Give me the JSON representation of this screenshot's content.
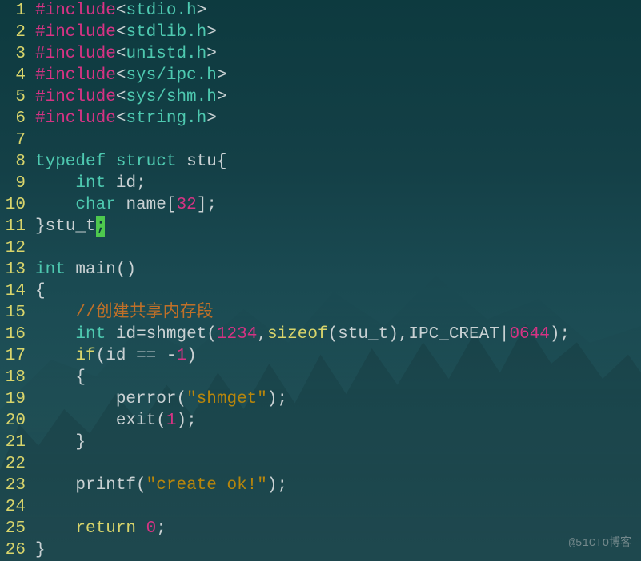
{
  "watermark": "@51CTO博客",
  "code_lines": [
    {
      "ln": "1",
      "tokens": [
        {
          "t": "#include",
          "c": "preproc"
        },
        {
          "t": "<",
          "c": "angle"
        },
        {
          "t": "stdio.h",
          "c": "header-name"
        },
        {
          "t": ">",
          "c": "angle"
        }
      ]
    },
    {
      "ln": "2",
      "tokens": [
        {
          "t": "#include",
          "c": "preproc"
        },
        {
          "t": "<",
          "c": "angle"
        },
        {
          "t": "stdlib.h",
          "c": "header-name"
        },
        {
          "t": ">",
          "c": "angle"
        }
      ]
    },
    {
      "ln": "3",
      "tokens": [
        {
          "t": "#include",
          "c": "preproc"
        },
        {
          "t": "<",
          "c": "angle"
        },
        {
          "t": "unistd.h",
          "c": "header-name"
        },
        {
          "t": ">",
          "c": "angle"
        }
      ]
    },
    {
      "ln": "4",
      "tokens": [
        {
          "t": "#include",
          "c": "preproc"
        },
        {
          "t": "<",
          "c": "angle"
        },
        {
          "t": "sys/ipc.h",
          "c": "header-name"
        },
        {
          "t": ">",
          "c": "angle"
        }
      ]
    },
    {
      "ln": "5",
      "tokens": [
        {
          "t": "#include",
          "c": "preproc"
        },
        {
          "t": "<",
          "c": "angle"
        },
        {
          "t": "sys/shm.h",
          "c": "header-name"
        },
        {
          "t": ">",
          "c": "angle"
        }
      ]
    },
    {
      "ln": "6",
      "tokens": [
        {
          "t": "#include",
          "c": "preproc"
        },
        {
          "t": "<",
          "c": "angle"
        },
        {
          "t": "string.h",
          "c": "header-name"
        },
        {
          "t": ">",
          "c": "angle"
        }
      ]
    },
    {
      "ln": "7",
      "tokens": []
    },
    {
      "ln": "8",
      "tokens": [
        {
          "t": "typedef",
          "c": "typedef"
        },
        {
          "t": " ",
          "c": "op"
        },
        {
          "t": "struct",
          "c": "struct-kw"
        },
        {
          "t": " ",
          "c": "op"
        },
        {
          "t": "stu",
          "c": "ident"
        },
        {
          "t": "{",
          "c": "brace"
        }
      ]
    },
    {
      "ln": "9",
      "tokens": [
        {
          "t": "    ",
          "c": "op"
        },
        {
          "t": "int",
          "c": "type"
        },
        {
          "t": " ",
          "c": "op"
        },
        {
          "t": "id",
          "c": "ident"
        },
        {
          "t": ";",
          "c": "op"
        }
      ]
    },
    {
      "ln": "10",
      "tokens": [
        {
          "t": "    ",
          "c": "op"
        },
        {
          "t": "char",
          "c": "type"
        },
        {
          "t": " ",
          "c": "op"
        },
        {
          "t": "name",
          "c": "ident"
        },
        {
          "t": "[",
          "c": "paren"
        },
        {
          "t": "32",
          "c": "num"
        },
        {
          "t": "]",
          "c": "paren"
        },
        {
          "t": ";",
          "c": "op"
        }
      ]
    },
    {
      "ln": "11",
      "tokens": [
        {
          "t": "}",
          "c": "brace"
        },
        {
          "t": "stu_t",
          "c": "ident"
        },
        {
          "t": ";",
          "c": "cursor"
        }
      ]
    },
    {
      "ln": "12",
      "tokens": []
    },
    {
      "ln": "13",
      "tokens": [
        {
          "t": "int",
          "c": "type"
        },
        {
          "t": " ",
          "c": "op"
        },
        {
          "t": "main",
          "c": "ident"
        },
        {
          "t": "()",
          "c": "paren"
        }
      ]
    },
    {
      "ln": "14",
      "tokens": [
        {
          "t": "{",
          "c": "brace"
        }
      ]
    },
    {
      "ln": "15",
      "tokens": [
        {
          "t": "    ",
          "c": "op"
        },
        {
          "t": "//创建共享内存段",
          "c": "comment"
        }
      ]
    },
    {
      "ln": "16",
      "tokens": [
        {
          "t": "    ",
          "c": "op"
        },
        {
          "t": "int",
          "c": "type"
        },
        {
          "t": " ",
          "c": "op"
        },
        {
          "t": "id",
          "c": "ident"
        },
        {
          "t": "=",
          "c": "op"
        },
        {
          "t": "shmget",
          "c": "func-call"
        },
        {
          "t": "(",
          "c": "paren"
        },
        {
          "t": "1234",
          "c": "num"
        },
        {
          "t": ",",
          "c": "op"
        },
        {
          "t": "sizeof",
          "c": "sizeof-kw"
        },
        {
          "t": "(",
          "c": "paren"
        },
        {
          "t": "stu_t",
          "c": "ident"
        },
        {
          "t": ")",
          "c": "paren"
        },
        {
          "t": ",",
          "c": "op"
        },
        {
          "t": "IPC_CREAT",
          "c": "ident"
        },
        {
          "t": "|",
          "c": "op"
        },
        {
          "t": "0",
          "c": "num"
        },
        {
          "t": "644",
          "c": "num"
        },
        {
          "t": ")",
          "c": "paren"
        },
        {
          "t": ";",
          "c": "op"
        }
      ]
    },
    {
      "ln": "17",
      "tokens": [
        {
          "t": "    ",
          "c": "op"
        },
        {
          "t": "if",
          "c": "if-kw"
        },
        {
          "t": "(",
          "c": "paren"
        },
        {
          "t": "id ",
          "c": "ident"
        },
        {
          "t": "==",
          "c": "op"
        },
        {
          "t": " ",
          "c": "op"
        },
        {
          "t": "-",
          "c": "op"
        },
        {
          "t": "1",
          "c": "num"
        },
        {
          "t": ")",
          "c": "paren"
        }
      ]
    },
    {
      "ln": "18",
      "tokens": [
        {
          "t": "    ",
          "c": "op"
        },
        {
          "t": "{",
          "c": "brace"
        }
      ]
    },
    {
      "ln": "19",
      "tokens": [
        {
          "t": "        ",
          "c": "op"
        },
        {
          "t": "perror",
          "c": "func-call"
        },
        {
          "t": "(",
          "c": "paren"
        },
        {
          "t": "\"shmget\"",
          "c": "str"
        },
        {
          "t": ")",
          "c": "paren"
        },
        {
          "t": ";",
          "c": "op"
        }
      ]
    },
    {
      "ln": "20",
      "tokens": [
        {
          "t": "        ",
          "c": "op"
        },
        {
          "t": "exit",
          "c": "func-call"
        },
        {
          "t": "(",
          "c": "paren"
        },
        {
          "t": "1",
          "c": "num"
        },
        {
          "t": ")",
          "c": "paren"
        },
        {
          "t": ";",
          "c": "op"
        }
      ]
    },
    {
      "ln": "21",
      "tokens": [
        {
          "t": "    ",
          "c": "op"
        },
        {
          "t": "}",
          "c": "brace"
        }
      ]
    },
    {
      "ln": "22",
      "tokens": []
    },
    {
      "ln": "23",
      "tokens": [
        {
          "t": "    ",
          "c": "op"
        },
        {
          "t": "printf",
          "c": "func-call"
        },
        {
          "t": "(",
          "c": "paren"
        },
        {
          "t": "\"create ok!\"",
          "c": "str"
        },
        {
          "t": ")",
          "c": "paren"
        },
        {
          "t": ";",
          "c": "op"
        }
      ]
    },
    {
      "ln": "24",
      "tokens": []
    },
    {
      "ln": "25",
      "tokens": [
        {
          "t": "    ",
          "c": "op"
        },
        {
          "t": "return",
          "c": "return-kw"
        },
        {
          "t": " ",
          "c": "op"
        },
        {
          "t": "0",
          "c": "num"
        },
        {
          "t": ";",
          "c": "op"
        }
      ]
    },
    {
      "ln": "26",
      "tokens": [
        {
          "t": "}",
          "c": "brace"
        }
      ]
    }
  ]
}
